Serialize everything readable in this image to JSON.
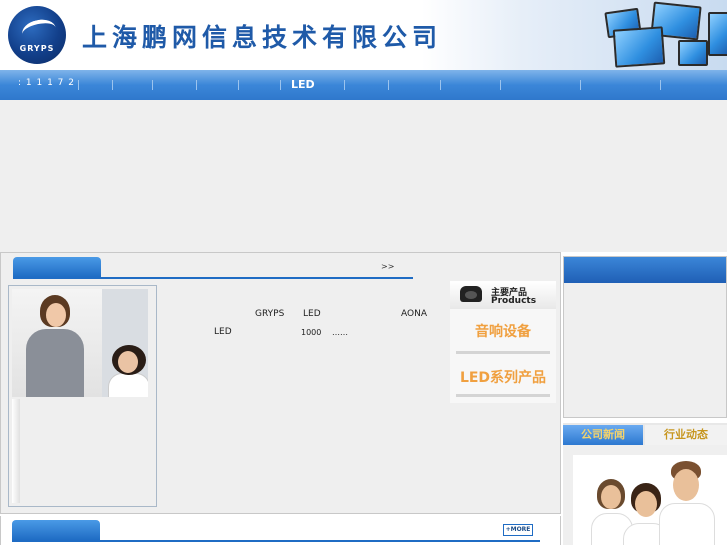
{
  "header": {
    "logo_text": "GRYPS",
    "company_title": "上海鹏网信息技术有限公司"
  },
  "nav": {
    "hotline": ": 1 1 1 7 2",
    "active_item": "LED"
  },
  "about": {
    "more_arrow": ">>",
    "text_brand": "GRYPS",
    "text_led1": "LED",
    "text_aona": "AONA",
    "text_led2": "LED",
    "text_count": "1000",
    "text_ellipsis": "……"
  },
  "products": {
    "heading_cn": "主要产品",
    "heading_en": "Products",
    "items": [
      "音响设备",
      "LED系列产品"
    ]
  },
  "news": {
    "more_label": "+MORE"
  },
  "right": {
    "tab_company_news": "公司新闻",
    "tab_industry_news": "行业动态"
  },
  "colors": {
    "nav_blue": "#3b86d8",
    "title_blue": "#1f5aa8",
    "product_orange": "#f0a040",
    "tab_gold": "#f5d36a"
  }
}
